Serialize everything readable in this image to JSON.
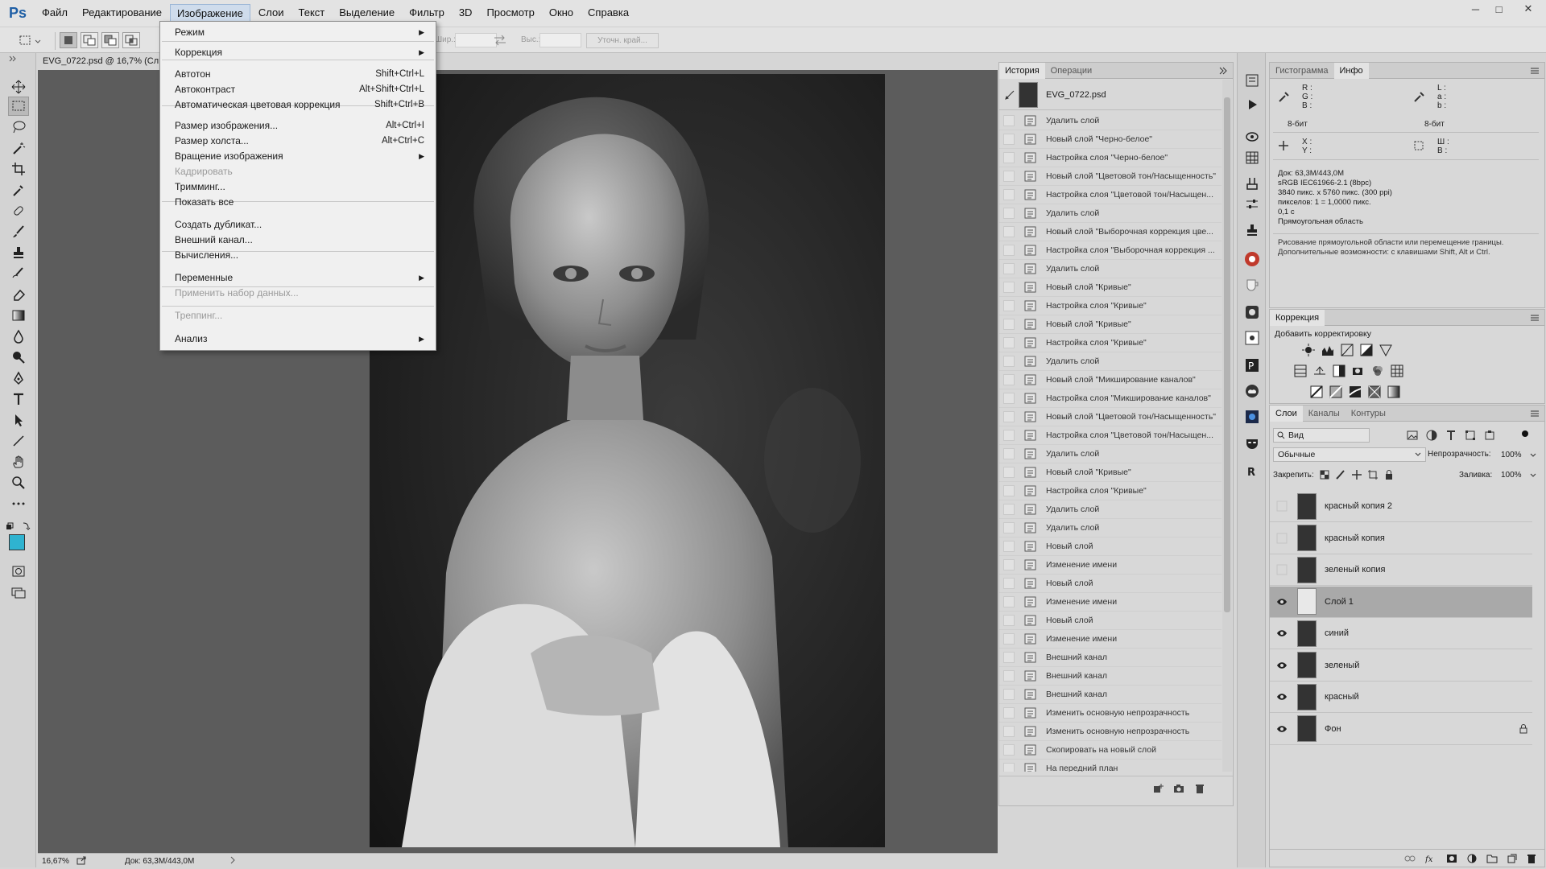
{
  "app": {
    "logo": "Ps"
  },
  "menubar": [
    "Файл",
    "Редактирование",
    "Изображение",
    "Слои",
    "Текст",
    "Выделение",
    "Фильтр",
    "3D",
    "Просмотр",
    "Окно",
    "Справка"
  ],
  "window_controls": {
    "min": "─",
    "max": "□",
    "close": "✕"
  },
  "options": {
    "width_label": "Шир.:",
    "height_label": "Выс.:",
    "refine_edge": "Уточн. край..."
  },
  "document": {
    "tab_title": "EVG_0722.psd @ 16,7% (Сл",
    "zoom": "16,67%",
    "doc_size": "Док: 63,3M/443,0M"
  },
  "image_menu": {
    "items": [
      {
        "label": "Режим",
        "shortcut": "",
        "submenu": true,
        "disabled": false
      },
      {
        "label": "Коррекция",
        "shortcut": "",
        "submenu": true,
        "disabled": false
      },
      {
        "label": "Автотон",
        "shortcut": "Shift+Ctrl+L",
        "submenu": false,
        "disabled": false
      },
      {
        "label": "Автоконтраст",
        "shortcut": "Alt+Shift+Ctrl+L",
        "submenu": false,
        "disabled": false
      },
      {
        "label": "Автоматическая цветовая коррекция",
        "shortcut": "Shift+Ctrl+B",
        "submenu": false,
        "disabled": false
      },
      {
        "label": "Размер изображения...",
        "shortcut": "Alt+Ctrl+I",
        "submenu": false,
        "disabled": false
      },
      {
        "label": "Размер холста...",
        "shortcut": "Alt+Ctrl+C",
        "submenu": false,
        "disabled": false
      },
      {
        "label": "Вращение изображения",
        "shortcut": "",
        "submenu": true,
        "disabled": false
      },
      {
        "label": "Кадрировать",
        "shortcut": "",
        "submenu": false,
        "disabled": true
      },
      {
        "label": "Тримминг...",
        "shortcut": "",
        "submenu": false,
        "disabled": false
      },
      {
        "label": "Показать все",
        "shortcut": "",
        "submenu": false,
        "disabled": false
      },
      {
        "label": "Создать дубликат...",
        "shortcut": "",
        "submenu": false,
        "disabled": false
      },
      {
        "label": "Внешний канал...",
        "shortcut": "",
        "submenu": false,
        "disabled": false
      },
      {
        "label": "Вычисления...",
        "shortcut": "",
        "submenu": false,
        "disabled": false
      },
      {
        "label": "Переменные",
        "shortcut": "",
        "submenu": true,
        "disabled": false
      },
      {
        "label": "Применить набор данных...",
        "shortcut": "",
        "submenu": false,
        "disabled": true
      },
      {
        "label": "Треппинг...",
        "shortcut": "",
        "submenu": false,
        "disabled": true
      },
      {
        "label": "Анализ",
        "shortcut": "",
        "submenu": true,
        "disabled": false
      }
    ]
  },
  "history": {
    "tabs": [
      "История",
      "Операции"
    ],
    "snapshot": "EVG_0722.psd",
    "items": [
      "Удалить слой",
      "Новый слой \"Черно-белое\"",
      "Настройка слоя \"Черно-белое\"",
      "Новый слой \"Цветовой тон/Насыщенность\"",
      "Настройка слоя \"Цветовой тон/Насыщен...",
      "Удалить слой",
      "Новый слой \"Выборочная коррекция цве...",
      "Настройка слоя \"Выборочная коррекция ...",
      "Удалить слой",
      "Новый слой \"Кривые\"",
      "Настройка слоя \"Кривые\"",
      "Новый слой \"Кривые\"",
      "Настройка слоя \"Кривые\"",
      "Удалить слой",
      "Новый слой \"Микширование каналов\"",
      "Настройка слоя \"Микширование каналов\"",
      "Новый слой \"Цветовой тон/Насыщенность\"",
      "Настройка слоя \"Цветовой тон/Насыщен...",
      "Удалить слой",
      "Новый слой \"Кривые\"",
      "Настройка слоя \"Кривые\"",
      "Удалить слой",
      "Удалить слой",
      "Новый слой",
      "Изменение имени",
      "Новый слой",
      "Изменение имени",
      "Новый слой",
      "Изменение имени",
      "Внешний канал",
      "Внешний канал",
      "Внешний канал",
      "Изменить основную непрозрачность",
      "Изменить основную непрозрачность",
      "Скопировать на новый слой",
      "На передний план"
    ]
  },
  "info": {
    "tabs": [
      "Гистограмма",
      "Инфо"
    ],
    "rgb": [
      "R :",
      "G :",
      "B :"
    ],
    "lab": [
      "L :",
      "a :",
      "b :"
    ],
    "bits1": "8-бит",
    "bits2": "8-бит",
    "xy": [
      "X :",
      "Y :"
    ],
    "wh": [
      "Ш :",
      "В :"
    ],
    "doc_lines": [
      "Док: 63,3M/443,0M",
      "sRGB IEC61966-2.1 (8bpc)",
      "3840 пикс. x 5760 пикс. (300 ppi)",
      "пикселов: 1 = 1,0000 пикс.",
      "0,1 с",
      "Прямоугольная область"
    ],
    "hint": "Рисование прямоугольной области или перемещение границы. Дополнительные возможности: с клавишами Shift, Alt и Ctrl."
  },
  "correction": {
    "title": "Коррекция",
    "subtitle": "Добавить корректировку"
  },
  "layers": {
    "tabs": [
      "Слои",
      "Каналы",
      "Контуры"
    ],
    "filter": "Вид",
    "blend": "Обычные",
    "opacity_label": "Непрозрачность:",
    "opacity": "100%",
    "lock_label": "Закрепить:",
    "fill_label": "Заливка:",
    "fill": "100%",
    "items": [
      {
        "name": "красный копия 2",
        "visible": false,
        "selected": false,
        "locked": false
      },
      {
        "name": "красный копия",
        "visible": false,
        "selected": false,
        "locked": false
      },
      {
        "name": "зеленый копия",
        "visible": false,
        "selected": false,
        "locked": false
      },
      {
        "name": "Слой 1",
        "visible": true,
        "selected": true,
        "locked": false
      },
      {
        "name": "синий",
        "visible": true,
        "selected": false,
        "locked": false
      },
      {
        "name": "зеленый",
        "visible": true,
        "selected": false,
        "locked": false
      },
      {
        "name": "красный",
        "visible": true,
        "selected": false,
        "locked": false
      },
      {
        "name": "Фон",
        "visible": true,
        "selected": false,
        "locked": true
      }
    ]
  },
  "colors": {
    "foreground": "#2fb3d0",
    "background": "#ffffff"
  }
}
